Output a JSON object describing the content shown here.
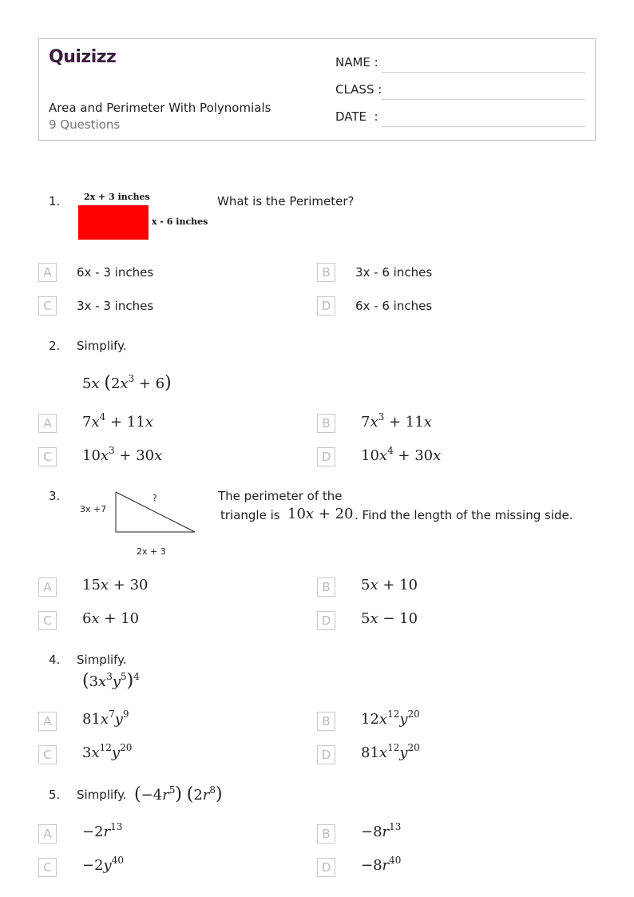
{
  "header": {
    "logo": "Quizizz",
    "title": "Area and Perimeter With Polynomials",
    "question_count": "9 Questions",
    "fields": [
      "NAME :",
      "CLASS :",
      "DATE  :"
    ]
  },
  "questions": [
    {
      "number": "1.",
      "prompt": "What is the Perimeter?",
      "figure": {
        "top_label": "2x + 3 inches",
        "side_label": "x - 6 inches",
        "fill_color": "#ff0000"
      },
      "options": [
        {
          "letter": "A",
          "text": "6x - 3 inches"
        },
        {
          "letter": "B",
          "text": "3x - 6 inches"
        },
        {
          "letter": "C",
          "text": "3x - 3 inches"
        },
        {
          "letter": "D",
          "text": "6x - 6 inches"
        }
      ]
    },
    {
      "number": "2.",
      "prompt": "Simplify.",
      "expression": "5x (2x^3 + 6)",
      "options": [
        {
          "letter": "A",
          "text": "7x^4 + 11x"
        },
        {
          "letter": "B",
          "text": "7x^3 + 11x"
        },
        {
          "letter": "C",
          "text": "10x^3 + 30x"
        },
        {
          "letter": "D",
          "text": "10x^4 + 30x"
        }
      ]
    },
    {
      "number": "3.",
      "prompt_line1": "The perimeter of the",
      "prompt_line2_pre": "triangle is",
      "prompt_expr": "10x + 20",
      "prompt_line2_post": ". Find the length of the missing side.",
      "figure": {
        "left_label": "3x +7",
        "hyp_label": "?",
        "bottom_label": "2x + 3"
      },
      "options": [
        {
          "letter": "A",
          "text": "15x + 30"
        },
        {
          "letter": "B",
          "text": "5x + 10"
        },
        {
          "letter": "C",
          "text": "6x + 10"
        },
        {
          "letter": "D",
          "text": "5x − 10"
        }
      ]
    },
    {
      "number": "4.",
      "prompt": "Simplify.",
      "expression": "(3x^3 y^5)^4",
      "options": [
        {
          "letter": "A",
          "text": "81x^7 y^9"
        },
        {
          "letter": "B",
          "text": "12x^12 y^20"
        },
        {
          "letter": "C",
          "text": "3x^12 y^20"
        },
        {
          "letter": "D",
          "text": "81x^12 y^20"
        }
      ]
    },
    {
      "number": "5.",
      "prompt": "Simplify.",
      "expression": "(−4r^5)(2r^8)",
      "options": [
        {
          "letter": "A",
          "text": "−2r^13"
        },
        {
          "letter": "B",
          "text": "−8r^13"
        },
        {
          "letter": "C",
          "text": "−2y^40"
        },
        {
          "letter": "D",
          "text": "−8r^40"
        }
      ]
    }
  ]
}
